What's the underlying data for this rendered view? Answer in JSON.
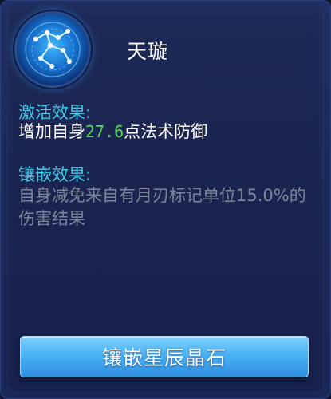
{
  "rune": {
    "name": "天璇",
    "icon": "star-constellation-icon"
  },
  "activation": {
    "label": "激活效果:",
    "text_before": "增加自身",
    "value": "27.6",
    "text_after": "点法术防御"
  },
  "inlay": {
    "label": "镶嵌效果:",
    "text": "自身减免来自有月刃标记单位15.0%的伤害结果"
  },
  "actions": {
    "inlay_button": "镶嵌星辰晶石"
  },
  "colors": {
    "section_label": "#45c8e8",
    "value_highlight": "#57d957",
    "inactive_text": "#7d869b",
    "button": "#4ab3f5"
  }
}
